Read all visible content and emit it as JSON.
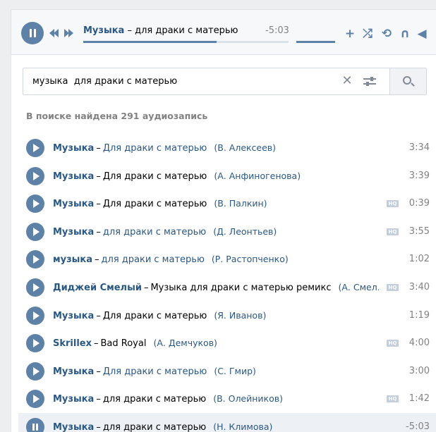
{
  "player": {
    "artist": "Музыка",
    "dash": " – ",
    "song": "для драки с матерью",
    "time": "-5:03",
    "progress_fraction": 0.65,
    "icons": [
      "pause-icon",
      "prev-icon",
      "next-icon",
      "add-icon",
      "shuffle-icon",
      "repeat-icon",
      "headphones-icon",
      "broadcast-icon"
    ],
    "add_glyph": "+",
    "shuffle_glyph": "⤮",
    "repeat_glyph": "⟲",
    "headphones_glyph": "∩",
    "broadcast_glyph": "◀"
  },
  "search": {
    "query": "музыка  для драки с матерью",
    "clear_glyph": "✕"
  },
  "summary": "В поиске найдена 291 аудиозапись",
  "colors": {
    "accent": "#5e81a8",
    "link": "#2a5885",
    "muted": "#828282",
    "active_row": "#edf0f5"
  },
  "tracks": [
    {
      "artist": "Музыка",
      "song": "Для драки с матерью",
      "song_link": true,
      "uploader": "(В. Алексеев)",
      "hq": false,
      "duration": "3:34"
    },
    {
      "artist": "Музыка",
      "song": "Для драки с матерью",
      "song_link": false,
      "uploader": "(А. Анфиногенова)",
      "hq": false,
      "duration": "3:39"
    },
    {
      "artist": "Музыка",
      "song": "Для драки с матерью",
      "song_link": false,
      "uploader": "(В. Палкин)",
      "hq": true,
      "duration": "0:39"
    },
    {
      "artist": "Музыка",
      "song": "для драки с матерью",
      "song_link": true,
      "uploader": "(Д. Леонтьев)",
      "hq": true,
      "duration": "3:55"
    },
    {
      "artist": "музыка",
      "song": "для драки с матерью",
      "song_link": true,
      "uploader": "(Р. Растопченко)",
      "hq": false,
      "duration": "1:02"
    },
    {
      "artist": "Диджей Смелый",
      "song": "Музыка для драки с матерью ремикс",
      "song_link": false,
      "uploader": "(А. Смел…",
      "hq": true,
      "duration": "3:40"
    },
    {
      "artist": "Музыка",
      "song": "Для драки с матерью",
      "song_link": false,
      "uploader": "(Я. Иванов)",
      "hq": false,
      "duration": "1:19"
    },
    {
      "artist": "Skrillex",
      "song": "Bad Royal",
      "song_link": false,
      "uploader": "(А. Демчуков)",
      "hq": true,
      "duration": "4:00"
    },
    {
      "artist": "Музыка",
      "song": "Для драки с матерью",
      "song_link": true,
      "uploader": "(С. Гмир)",
      "hq": false,
      "duration": "3:00"
    },
    {
      "artist": "Музыка",
      "song": "для драки с матерью",
      "song_link": false,
      "uploader": "(В. Олейников)",
      "hq": true,
      "duration": "1:42"
    },
    {
      "artist": "Музыка",
      "song": "для драки с матерью",
      "song_link": false,
      "uploader": "(Н. Климова)",
      "hq": false,
      "duration": "-5:03",
      "active": true
    }
  ],
  "hq_label": "HQ"
}
